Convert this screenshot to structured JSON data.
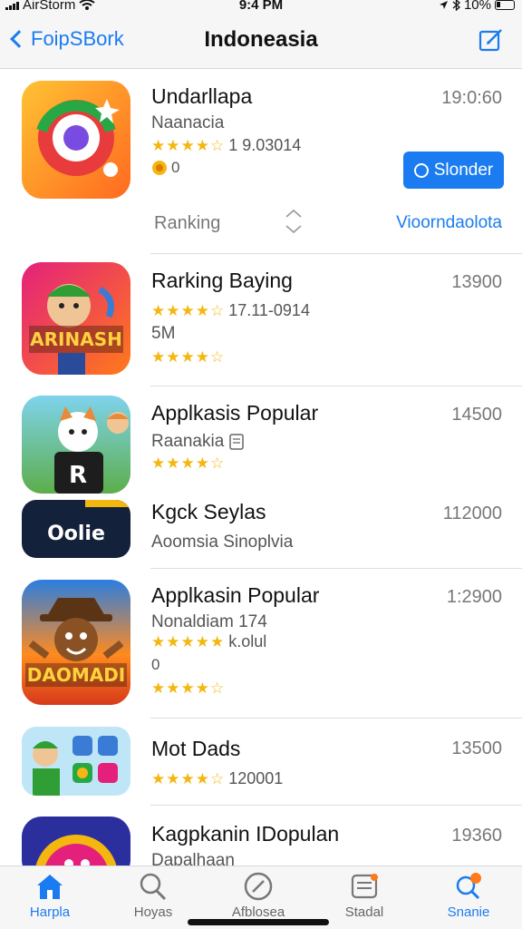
{
  "status_bar": {
    "carrier": "AirStorm",
    "time": "9:4 PM",
    "battery": "10%"
  },
  "nav": {
    "back_label": "FoipSBork",
    "title": "Indoneasia",
    "compose_icon": "compose-icon"
  },
  "apps": [
    {
      "name": "Undarllapa",
      "subtitle": "Naanacia",
      "size": "19:0:60",
      "stars": "★★★★☆",
      "rating_count": "1 9.03014",
      "badge": "0",
      "button_label": "Slonder",
      "ranking_label": "Ranking",
      "ranking_link": "Vioorndaolota"
    },
    {
      "name": "Rarking Baying",
      "size": "13900",
      "stars": "★★★★☆",
      "rating_count": "17.11-0914",
      "extra": "5M",
      "stars2": "★★★★☆",
      "icon_text": "ARINASH"
    },
    {
      "name": "Applkasis Popular",
      "subtitle": "Raanakia",
      "size": "14500",
      "stars": "★★★★☆"
    },
    {
      "name": "Kgck Seylas",
      "subtitle": "Aoomsia Sinoplvia",
      "size": "112000",
      "icon_text": "Oolie"
    },
    {
      "name": "Applkasin Popular",
      "subtitle": "Nonaldiam 174",
      "size": "1:2900",
      "stars": "★★★★★",
      "rating_count": "k.olul",
      "extra": "0",
      "stars2": "★★★★☆",
      "icon_text": "DAOMADI"
    },
    {
      "name": "Mot Dads",
      "size": "13500",
      "stars": "★★★★☆",
      "rating_count": "120001"
    },
    {
      "name": "Kagpkanin IDopulan",
      "subtitle": "Dapalhaan",
      "size": "19360"
    }
  ],
  "tabs": [
    {
      "label": "Harpla",
      "icon": "home-icon",
      "active": true
    },
    {
      "label": "Hoyas",
      "icon": "search-icon",
      "active": false
    },
    {
      "label": "Afblosea",
      "icon": "compass-icon",
      "active": false
    },
    {
      "label": "Stadal",
      "icon": "updates-icon",
      "active": false
    },
    {
      "label": "Snanie",
      "icon": "search-badge-icon",
      "active": true
    }
  ],
  "colors": {
    "accent": "#1a7cf0",
    "star": "#f3b70f",
    "bar_bg": "#f6f6f7"
  }
}
